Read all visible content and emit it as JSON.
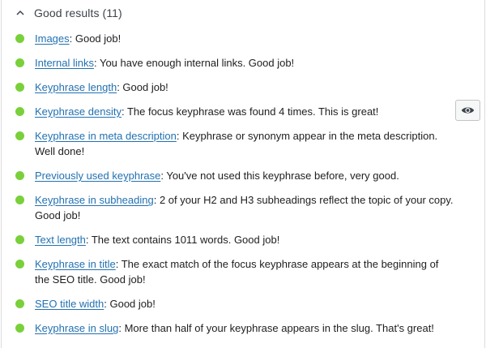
{
  "section": {
    "title": "Good results (11)",
    "bullet_color": "#7ad03a"
  },
  "results": [
    {
      "link": "Images",
      "message": ": Good job!"
    },
    {
      "link": "Internal links",
      "message": ": You have enough internal links. Good job!"
    },
    {
      "link": "Keyphrase length",
      "message": ": Good job!"
    },
    {
      "link": "Keyphrase density",
      "message": ": The focus keyphrase was found 4 times. This is great!",
      "has_eye_button": true
    },
    {
      "link": "Keyphrase in meta description",
      "message": ": Keyphrase or synonym appear in the meta description. Well done!"
    },
    {
      "link": "Previously used keyphrase",
      "message": ": You've not used this keyphrase before, very good."
    },
    {
      "link": "Keyphrase in subheading",
      "message": ": 2 of your H2 and H3 subheadings reflect the topic of your copy. Good job!"
    },
    {
      "link": "Text length",
      "message": ": The text contains 1011 words. Good job!"
    },
    {
      "link": "Keyphrase in title",
      "message": ": The exact match of the focus keyphrase appears at the beginning of the SEO title. Good job!"
    },
    {
      "link": "SEO title width",
      "message": ": Good job!"
    },
    {
      "link": "Keyphrase in slug",
      "message": ": More than half of your keyphrase appears in the slug. That's great!"
    }
  ],
  "icons": {
    "collapse": "chevron-up-icon",
    "bullet": "status-dot-icon",
    "highlight": "eye-icon"
  }
}
